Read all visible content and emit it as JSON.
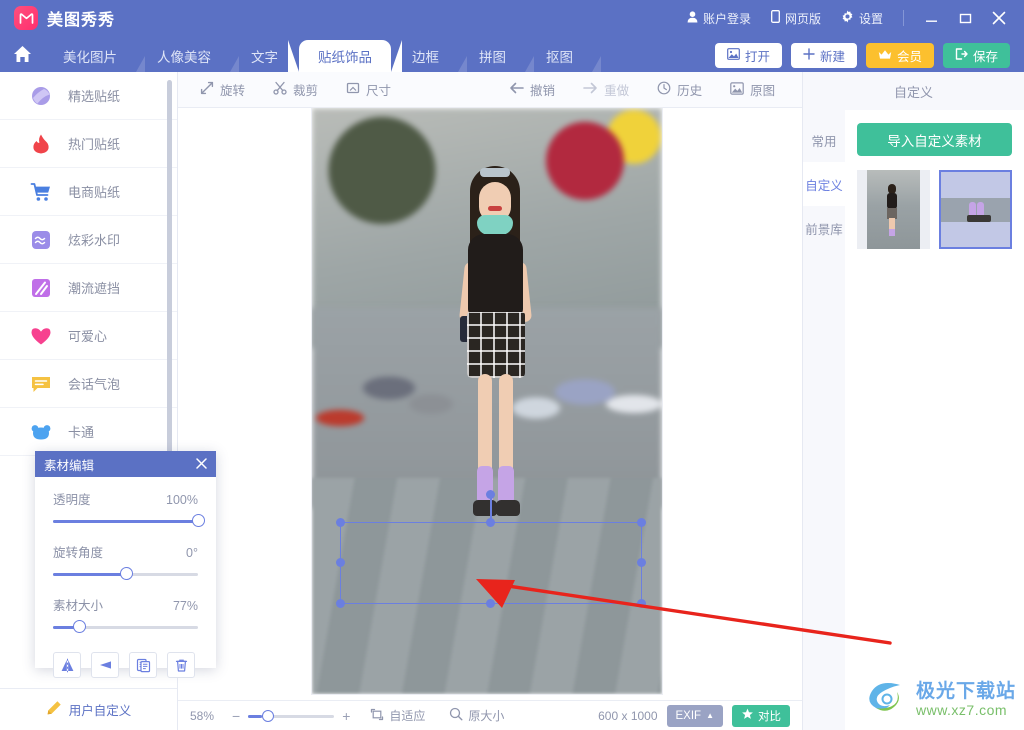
{
  "app": {
    "name": "美图秀秀",
    "logo_icon": "meitu-logo-icon"
  },
  "titlebar": {
    "account_label": "账户登录",
    "account_icon": "user-icon",
    "web_label": "网页版",
    "web_icon": "tablet-icon",
    "settings_label": "设置",
    "settings_icon": "gear-icon",
    "minimize_icon": "minimize-icon",
    "maximize_icon": "maximize-icon",
    "close_icon": "close-icon"
  },
  "tabbar": {
    "home_icon": "home-icon",
    "tabs": [
      {
        "label": "美化图片",
        "active": false
      },
      {
        "label": "人像美容",
        "active": false
      },
      {
        "label": "文字",
        "active": false
      },
      {
        "label": "贴纸饰品",
        "active": true
      },
      {
        "label": "边框",
        "active": false
      },
      {
        "label": "拼图",
        "active": false
      },
      {
        "label": "抠图",
        "active": false
      }
    ],
    "actions": [
      {
        "label": "打开",
        "icon": "image-open-icon",
        "style": "white"
      },
      {
        "label": "新建",
        "icon": "plus-icon",
        "style": "white"
      },
      {
        "label": "会员",
        "icon": "crown-icon",
        "style": "gold"
      },
      {
        "label": "保存",
        "icon": "save-exit-icon",
        "style": "green"
      }
    ]
  },
  "toolbar": {
    "items": [
      {
        "label": "旋转",
        "icon": "rotate-icon",
        "dim": false
      },
      {
        "label": "裁剪",
        "icon": "scissors-icon",
        "dim": false
      },
      {
        "label": "尺寸",
        "icon": "resize-icon",
        "dim": false
      }
    ],
    "history_items": [
      {
        "label": "撤销",
        "icon": "undo-arrow-icon",
        "dim": false
      },
      {
        "label": "重做",
        "icon": "redo-arrow-icon",
        "dim": true
      },
      {
        "label": "历史",
        "icon": "clock-icon",
        "dim": false
      },
      {
        "label": "原图",
        "icon": "original-image-icon",
        "dim": false
      }
    ]
  },
  "sidebar": {
    "items": [
      {
        "label": "精选贴纸",
        "icon": "featured-sticker-icon"
      },
      {
        "label": "热门贴纸",
        "icon": "flame-icon"
      },
      {
        "label": "电商贴纸",
        "icon": "cart-icon"
      },
      {
        "label": "炫彩水印",
        "icon": "watermark-icon"
      },
      {
        "label": "潮流遮挡",
        "icon": "trend-cover-icon"
      },
      {
        "label": "可爱心",
        "icon": "heart-icon"
      },
      {
        "label": "会话气泡",
        "icon": "speech-bubble-icon"
      },
      {
        "label": "卡通",
        "icon": "cartoon-bear-icon"
      }
    ],
    "footer": {
      "label": "用户自定义",
      "icon": "pencil-icon"
    }
  },
  "material_panel": {
    "title": "素材编辑",
    "close_icon": "close-icon",
    "sliders": [
      {
        "label": "透明度",
        "value": "100%",
        "percent": 100
      },
      {
        "label": "旋转角度",
        "value": "0°",
        "percent": 50
      },
      {
        "label": "素材大小",
        "value": "77%",
        "percent": 18
      }
    ],
    "tools": [
      {
        "icon": "flip-horizontal-icon"
      },
      {
        "icon": "flip-vertical-icon"
      },
      {
        "icon": "copy-icon"
      },
      {
        "icon": "trash-icon"
      }
    ]
  },
  "right_panel": {
    "title": "自定义",
    "tabs": [
      {
        "label": "常用",
        "active": false
      },
      {
        "label": "自定义",
        "active": true
      },
      {
        "label": "前景库",
        "active": false
      }
    ],
    "import_button": "导入自定义素材",
    "thumbnails": [
      {
        "name": "thumbnail-full-photo",
        "selected": false
      },
      {
        "name": "thumbnail-legs-crop",
        "selected": true
      }
    ]
  },
  "statusbar": {
    "zoom_level": "58%",
    "zoom_minus": "−",
    "zoom_plus": "+",
    "fit_label": "自适应",
    "fit_icon": "fit-screen-icon",
    "actual_label": "原大小",
    "actual_icon": "magnifier-icon",
    "dimensions": "600 x 1000",
    "exif_label": "EXIF",
    "exif_caret": "▲",
    "compare_label": "对比",
    "compare_icon": "star-compare-icon"
  },
  "watermark": {
    "logo_icon": "aurora-swoosh-icon",
    "name": "极光下载站",
    "url": "www.xz7.com"
  },
  "annotation": {
    "arrow_color": "#e8241c",
    "name": "red-pointer-arrow"
  },
  "theme": {
    "primary": "#5b71c4",
    "accent": "#6b7fe0",
    "green": "#3fc09a",
    "gold": "#fcc02e",
    "text_muted": "#9096ad"
  }
}
